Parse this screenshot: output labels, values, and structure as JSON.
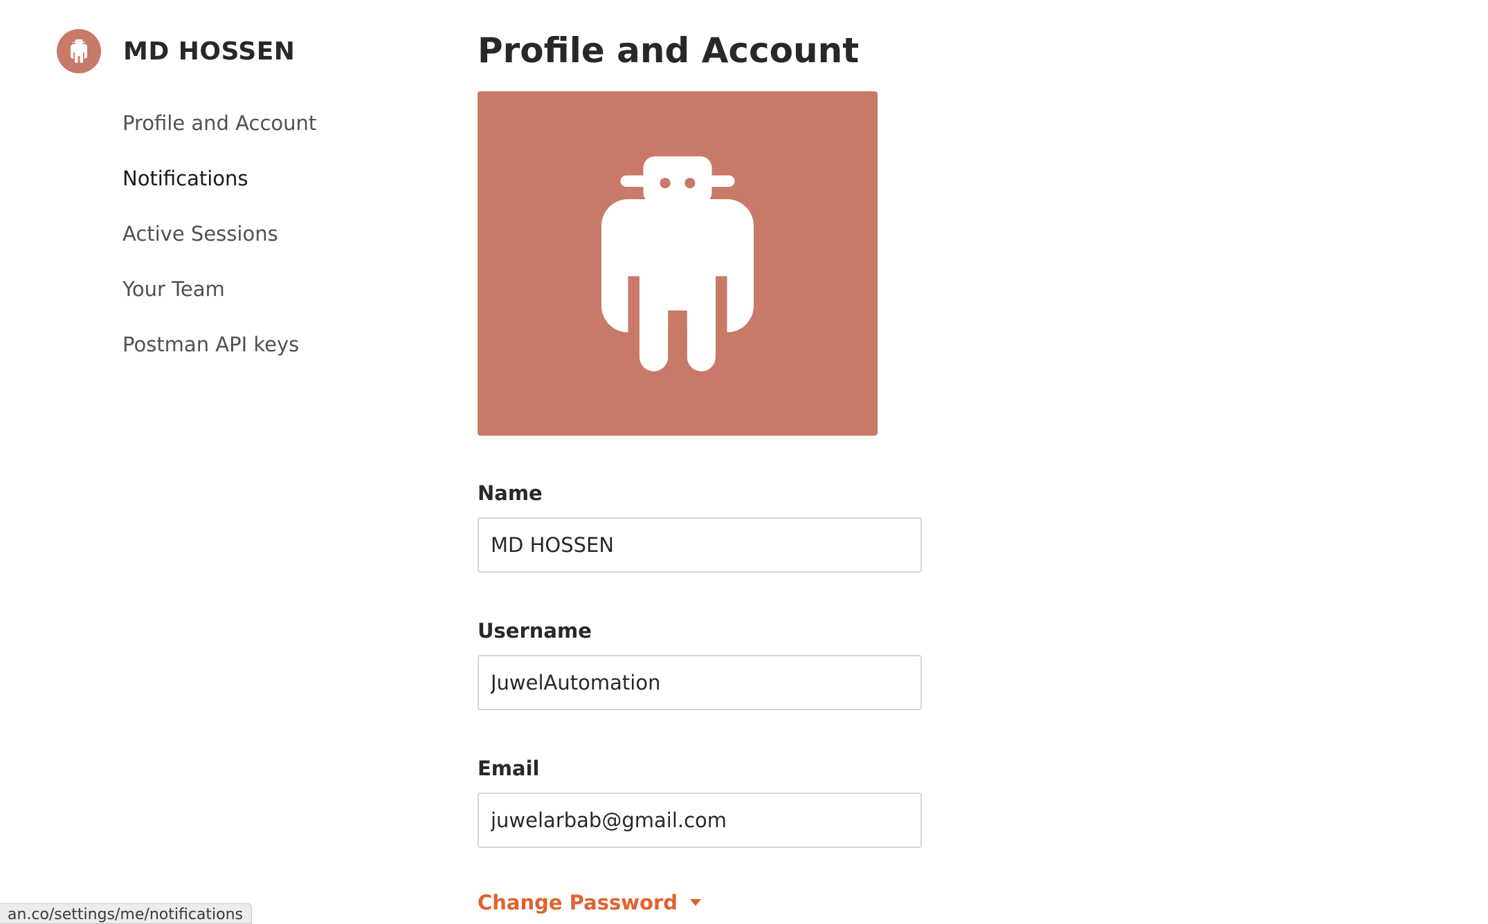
{
  "sidebar": {
    "user_name": "MD HOSSEN",
    "avatar_icon": "robot-avatar-icon",
    "items": [
      {
        "label": "Profile and Account"
      },
      {
        "label": "Notifications"
      },
      {
        "label": "Active Sessions"
      },
      {
        "label": "Your Team"
      },
      {
        "label": "Postman API keys"
      }
    ]
  },
  "main": {
    "title": "Profile and Account",
    "avatar_icon": "robot-avatar-icon",
    "avatar_color": "#c87968",
    "fields": {
      "name": {
        "label": "Name",
        "value": "MD HOSSEN"
      },
      "username": {
        "label": "Username",
        "value": "JuwelAutomation"
      },
      "email": {
        "label": "Email",
        "value": "juwelarbab@gmail.com"
      }
    },
    "change_password": {
      "label": "Change Password",
      "icon": "caret-down-icon",
      "color": "#e0622f"
    }
  },
  "status_bar": {
    "url": "an.co/settings/me/notifications"
  }
}
